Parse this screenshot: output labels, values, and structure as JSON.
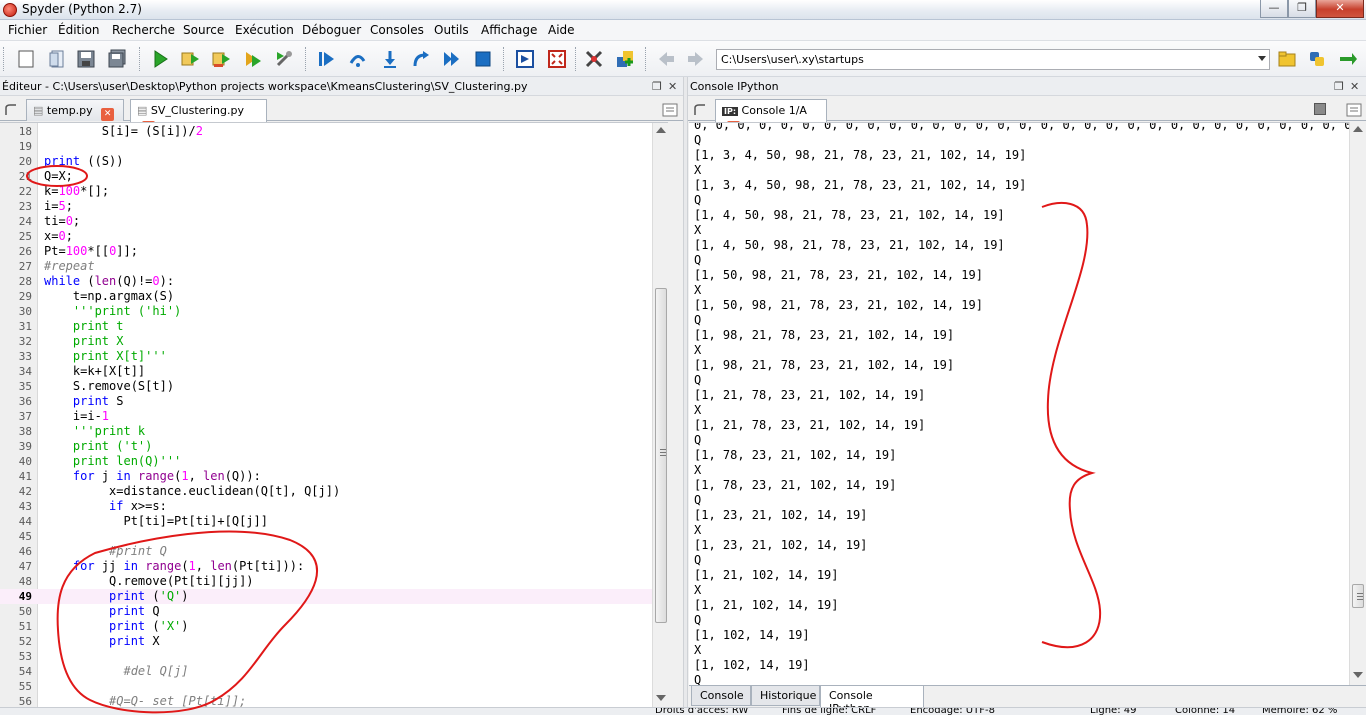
{
  "window": {
    "title": "Spyder (Python 2.7)",
    "minimize": "—",
    "maximize": "❐",
    "close": "✕"
  },
  "menu": [
    "Fichier",
    "Édition",
    "Recherche",
    "Source",
    "Exécution",
    "Déboguer",
    "Consoles",
    "Outils",
    "Affichage",
    "Aide"
  ],
  "toolbar": {
    "path_value": "C:\\Users\\user\\.xy\\startups"
  },
  "editor": {
    "pane_title": "Éditeur - C:\\Users\\user\\Desktop\\Python projects workspace\\KmeansClustering\\SV_Clustering.py",
    "tabs": [
      {
        "label": "temp.py",
        "active": false
      },
      {
        "label": "SV_Clustering.py",
        "active": true
      }
    ],
    "current_line": 49,
    "lines": [
      {
        "n": 18,
        "code": "        S[i]= (S[i])/2"
      },
      {
        "n": 19,
        "code": ""
      },
      {
        "n": 20,
        "code": "print ((S))"
      },
      {
        "n": 21,
        "code": "Q=X;"
      },
      {
        "n": 22,
        "code": "k=100*[];"
      },
      {
        "n": 23,
        "code": "i=5;"
      },
      {
        "n": 24,
        "code": "ti=0;"
      },
      {
        "n": 25,
        "code": "x=0;"
      },
      {
        "n": 26,
        "code": "Pt=100*[[0]];"
      },
      {
        "n": 27,
        "code": "#repeat"
      },
      {
        "n": 28,
        "code": "while (len(Q)!=0):"
      },
      {
        "n": 29,
        "code": "    t=np.argmax(S)"
      },
      {
        "n": 30,
        "code": "    '''print ('hi')"
      },
      {
        "n": 31,
        "code": "    print t"
      },
      {
        "n": 32,
        "code": "    print X"
      },
      {
        "n": 33,
        "code": "    print X[t]'''"
      },
      {
        "n": 34,
        "code": "    k=k+[X[t]]"
      },
      {
        "n": 35,
        "code": "    S.remove(S[t])"
      },
      {
        "n": 36,
        "code": "    print S"
      },
      {
        "n": 37,
        "code": "    i=i-1"
      },
      {
        "n": 38,
        "code": "    '''print k"
      },
      {
        "n": 39,
        "code": "    print ('t')"
      },
      {
        "n": 40,
        "code": "    print len(Q)'''"
      },
      {
        "n": 41,
        "code": "    for j in range(1, len(Q)):"
      },
      {
        "n": 42,
        "code": "         x=distance.euclidean(Q[t], Q[j])"
      },
      {
        "n": 43,
        "code": "         if x>=s:"
      },
      {
        "n": 44,
        "code": "           Pt[ti]=Pt[ti]+[Q[j]]"
      },
      {
        "n": 45,
        "code": ""
      },
      {
        "n": 46,
        "code": "         #print Q"
      },
      {
        "n": 47,
        "code": "    for jj in range(1, len(Pt[ti])):"
      },
      {
        "n": 48,
        "code": "         Q.remove(Pt[ti][jj])"
      },
      {
        "n": 49,
        "code": "         print ('Q')"
      },
      {
        "n": 50,
        "code": "         print Q"
      },
      {
        "n": 51,
        "code": "         print ('X')"
      },
      {
        "n": 52,
        "code": "         print X"
      },
      {
        "n": 53,
        "code": ""
      },
      {
        "n": 54,
        "code": "           #del Q[j]"
      },
      {
        "n": 55,
        "code": ""
      },
      {
        "n": 56,
        "code": "         #Q=Q- set [Pt[ti]];"
      }
    ]
  },
  "console": {
    "pane_title": "Console IPython",
    "tab_label": "Console 1/A",
    "tab_icon_text": "IP:",
    "lines": [
      "0, 0, 0, 0, 0, 0, 0, 0, 0, 0, 0, 0, 0, 0, 0, 0, 0, 0, 0, 0, 0, 0, 0, 0, 0, 0, 0, 0, 0, 0, 0, 0, 0, 0, 0, 0]",
      "Q",
      "[1, 3, 4, 50, 98, 21, 78, 23, 21, 102, 14, 19]",
      "X",
      "[1, 3, 4, 50, 98, 21, 78, 23, 21, 102, 14, 19]",
      "Q",
      "[1, 4, 50, 98, 21, 78, 23, 21, 102, 14, 19]",
      "X",
      "[1, 4, 50, 98, 21, 78, 23, 21, 102, 14, 19]",
      "Q",
      "[1, 50, 98, 21, 78, 23, 21, 102, 14, 19]",
      "X",
      "[1, 50, 98, 21, 78, 23, 21, 102, 14, 19]",
      "Q",
      "[1, 98, 21, 78, 23, 21, 102, 14, 19]",
      "X",
      "[1, 98, 21, 78, 23, 21, 102, 14, 19]",
      "Q",
      "[1, 21, 78, 23, 21, 102, 14, 19]",
      "X",
      "[1, 21, 78, 23, 21, 102, 14, 19]",
      "Q",
      "[1, 78, 23, 21, 102, 14, 19]",
      "X",
      "[1, 78, 23, 21, 102, 14, 19]",
      "Q",
      "[1, 23, 21, 102, 14, 19]",
      "X",
      "[1, 23, 21, 102, 14, 19]",
      "Q",
      "[1, 21, 102, 14, 19]",
      "X",
      "[1, 21, 102, 14, 19]",
      "Q",
      "[1, 102, 14, 19]",
      "X",
      "[1, 102, 14, 19]",
      "Q"
    ],
    "bottom_tabs": [
      {
        "label": "Console",
        "active": false
      },
      {
        "label": "Historique",
        "active": false
      },
      {
        "label": "Console IPython",
        "active": true
      }
    ]
  },
  "statusbar": {
    "permissions": "Droits d'accès: RW",
    "eol": "Fins de ligne: CRLF",
    "encoding": "Encodage: UTF-8",
    "line": "Ligne: 49",
    "column": "Colonne: 14",
    "memory": "Mémoire: 62 %"
  },
  "colors": {
    "keyword": "#0000ff",
    "builtin": "#900090",
    "string": "#00aa00",
    "comment": "#7f7f7f",
    "number": "#ff00ff",
    "annotation": "#e01818",
    "current_line_bg": "#fbeefa"
  }
}
